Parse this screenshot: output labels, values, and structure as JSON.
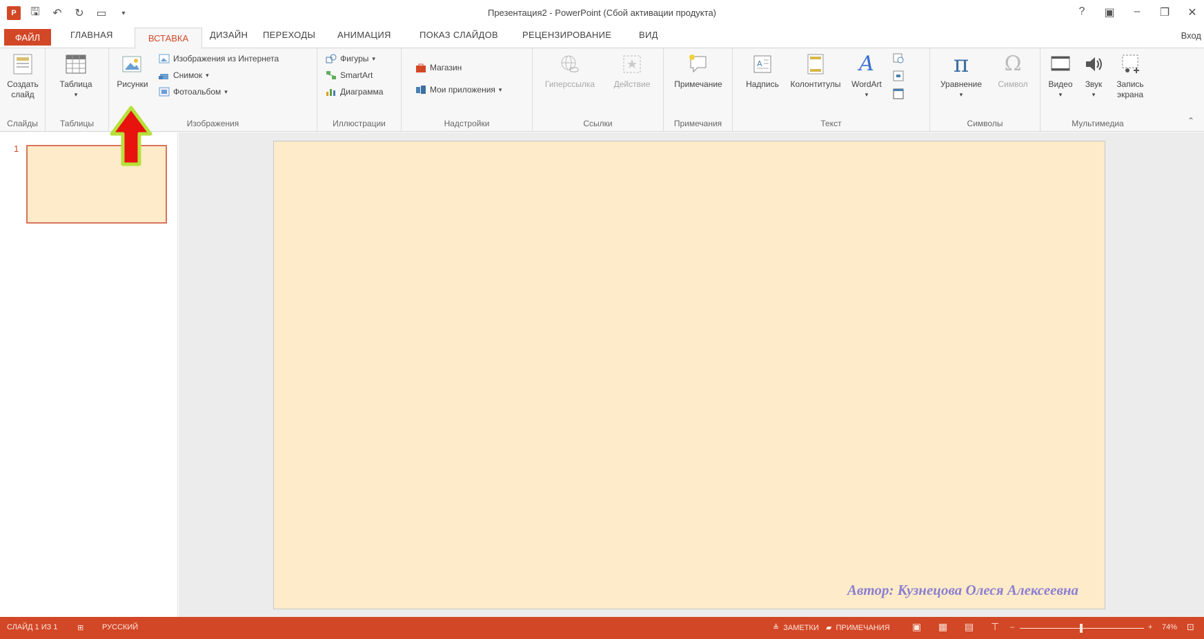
{
  "window": {
    "title": "Презентация2 - PowerPoint (Сбой активации продукта)",
    "help": "?",
    "signin": "Вход"
  },
  "tabs": {
    "file": "ФАЙЛ",
    "items": [
      "ГЛАВНАЯ",
      "ВСТАВКА",
      "ДИЗАЙН",
      "ПЕРЕХОДЫ",
      "АНИМАЦИЯ",
      "ПОКАЗ СЛАЙДОВ",
      "РЕЦЕНЗИРОВАНИЕ",
      "ВИД"
    ],
    "active": "ВСТАВКА"
  },
  "ribbon": {
    "slides": {
      "new_slide": "Создать слайд",
      "label": "Слайды"
    },
    "tables": {
      "table": "Таблица",
      "label": "Таблицы"
    },
    "images": {
      "pictures": "Рисунки",
      "online": "Изображения из Интернета",
      "screenshot": "Снимок",
      "album": "Фотоальбом",
      "label": "Изображения"
    },
    "illustrations": {
      "shapes": "Фигуры",
      "smartart": "SmartArt",
      "chart": "Диаграмма",
      "label": "Иллюстрации"
    },
    "addins": {
      "store": "Магазин",
      "myapps": "Мои приложения",
      "label": "Надстройки"
    },
    "links": {
      "hyperlink": "Гиперссылка",
      "action": "Действие",
      "label": "Ссылки"
    },
    "comments": {
      "comment": "Примечание",
      "label": "Примечания"
    },
    "text": {
      "textbox": "Надпись",
      "headerfooter": "Колонтитулы",
      "wordart": "WordArt",
      "label": "Текст"
    },
    "symbols": {
      "equation": "Уравнение",
      "symbol": "Символ",
      "label": "Символы"
    },
    "media": {
      "video": "Видео",
      "audio": "Звук",
      "screen_recording": "Запись экрана",
      "label": "Мультимедиа"
    }
  },
  "thumbs": {
    "number": "1"
  },
  "slide": {
    "author": "Автор: Кузнецова Олеся Алексеевна"
  },
  "status": {
    "slide_info": "СЛАЙД 1 ИЗ 1",
    "language": "РУССКИЙ",
    "notes": "ЗАМЕТКИ",
    "comments": "ПРИМЕЧАНИЯ",
    "zoom": "74%"
  },
  "colors": {
    "accent": "#d24726",
    "slide_bg": "#fdebc9",
    "author_text": "#8c7fd0",
    "arrow_fill": "#e8130f",
    "arrow_outline": "#b8e03a"
  },
  "annotation": {
    "arrow": "red-up-arrow-pointing-to-pictures"
  }
}
